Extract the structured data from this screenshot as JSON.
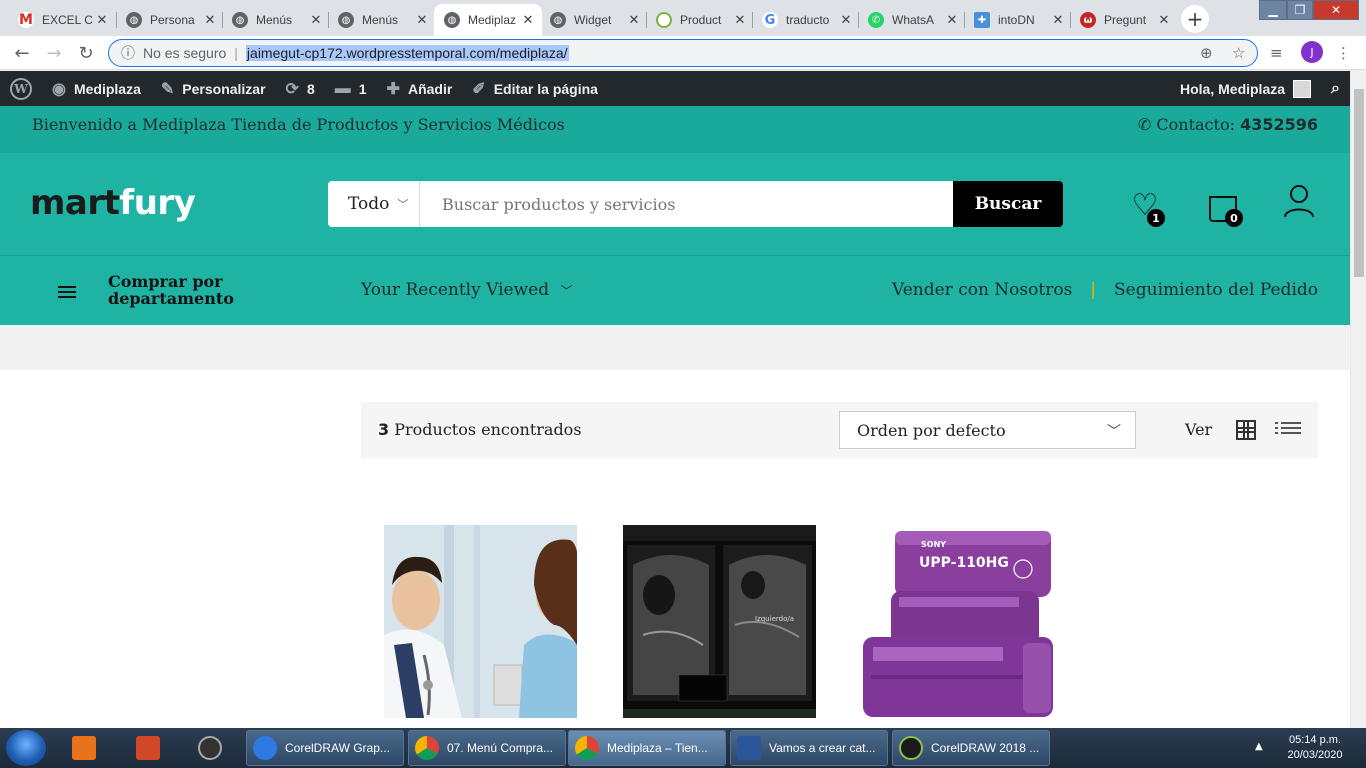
{
  "browser": {
    "tabs": [
      {
        "label": "EXCEL C",
        "icon": "gmail-icon",
        "color": "#d93025"
      },
      {
        "label": "Persona",
        "icon": "globe-icon",
        "color": "#5f6368"
      },
      {
        "label": "Menús",
        "icon": "globe-icon",
        "color": "#5f6368"
      },
      {
        "label": "Menús",
        "icon": "globe-icon",
        "color": "#5f6368"
      },
      {
        "label": "Mediplaz",
        "icon": "globe-icon",
        "color": "#5f6368",
        "active": true
      },
      {
        "label": "Widget",
        "icon": "globe-icon",
        "color": "#5f6368"
      },
      {
        "label": "Product",
        "icon": "loading-icon",
        "color": "#7cb342"
      },
      {
        "label": "traducto",
        "icon": "google-icon",
        "color": "#4285f4"
      },
      {
        "label": "WhatsA",
        "icon": "whatsapp-icon",
        "color": "#25d366"
      },
      {
        "label": "intoDN",
        "icon": "puzzle-icon",
        "color": "#4a90d9"
      },
      {
        "label": "Pregunt",
        "icon": "quora-icon",
        "color": "#c62828"
      }
    ],
    "address": {
      "security": "No es seguro",
      "url": "jaimegut-cp172.wordpresstemporal.com/mediplaza/"
    },
    "profile_initial": "J"
  },
  "wp_admin_bar": {
    "site": "Mediplaza",
    "customize": "Personalizar",
    "updates": "8",
    "comments": "1",
    "add": "Añadir",
    "edit": "Editar la página",
    "greeting": "Hola, Mediplaza"
  },
  "topbar": {
    "welcome": "Bienvenido a Mediplaza Tienda de Productos y Servicios Médicos",
    "contact_label": "Contacto:",
    "contact_number": "4352596"
  },
  "header": {
    "logo_part1": "mart",
    "logo_part2": "fury",
    "category": "Todo",
    "search_placeholder": "Buscar productos y servicios",
    "search_button": "Buscar",
    "wishlist_count": "1",
    "cart_count": "0"
  },
  "nav": {
    "departments": "Comprar por departamento",
    "recently_viewed": "Your Recently Viewed",
    "sell": "Vender con Nosotros",
    "tracking": "Seguimiento del Pedido"
  },
  "shop": {
    "count": "3",
    "found_label": "Productos encontrados",
    "order": "Orden por defecto",
    "view_label": "Ver",
    "ultrasound_labels": [
      "Izquierdo/a"
    ],
    "product3_label": "UPP-110HG",
    "product3_brand": "SONY"
  },
  "taskbar": {
    "apps": [
      {
        "label": "CorelDRAW Grap...",
        "color": "#2d7be0"
      },
      {
        "label": "07. Menú Compra...",
        "color": "#e8453c"
      },
      {
        "label": "Mediplaza – Tien...",
        "color": "#e8453c"
      },
      {
        "label": "Vamos a crear cat...",
        "color": "#2b579a"
      },
      {
        "label": "CorelDRAW 2018 ...",
        "color": "#1a1a1a"
      }
    ],
    "time": "05:14 p.m.",
    "date": "20/03/2020"
  },
  "colors": {
    "brand_teal": "#1fb3a3",
    "top_teal": "#1aaa9b",
    "accent_yellow": "#f0b400"
  }
}
